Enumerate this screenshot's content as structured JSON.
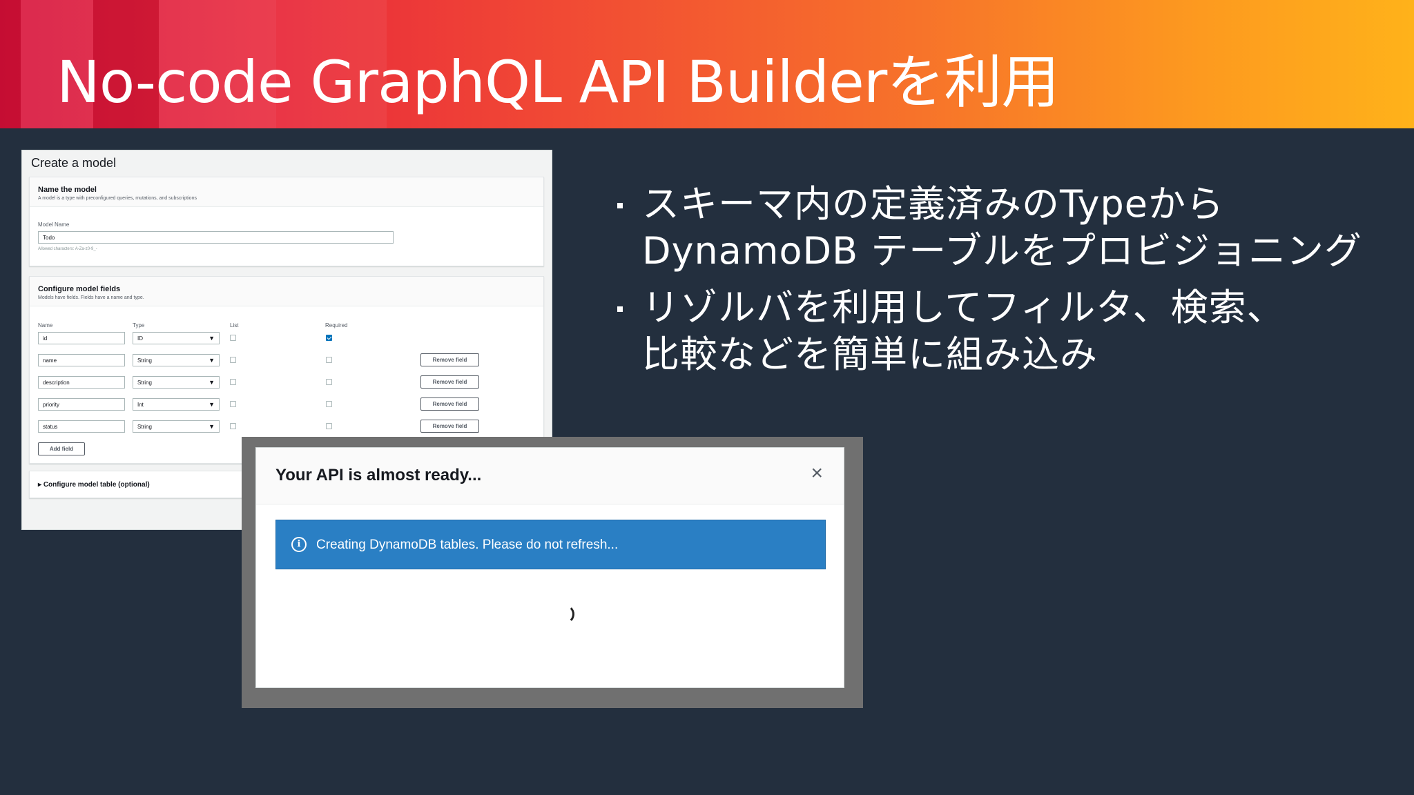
{
  "slide": {
    "title": "No-code GraphQL API Builderを利用",
    "bullets": [
      {
        "lines": [
          "スキーマ内の定義済みのTypeから",
          "DynamoDB テーブルをプロビジョニング"
        ]
      },
      {
        "lines": [
          "リゾルバを利用してフィルタ、検索、",
          "比較などを簡単に組み込み"
        ]
      }
    ]
  },
  "create_model": {
    "title": "Create a model",
    "name_section": {
      "title": "Name the model",
      "description": "A model is a type with preconfigured queries, mutations, and subscriptions",
      "field_label": "Model Name",
      "value": "Todo",
      "hint": "Allowed characters: A-Za-z0-9_-"
    },
    "fields_section": {
      "title": "Configure model fields",
      "description": "Models have fields. Fields have a name and type.",
      "headers": {
        "name": "Name",
        "type": "Type",
        "list": "List",
        "required": "Required"
      },
      "rows": [
        {
          "name": "id",
          "type": "ID",
          "list": false,
          "required": true,
          "removable": false
        },
        {
          "name": "name",
          "type": "String",
          "list": false,
          "required": false,
          "removable": true
        },
        {
          "name": "description",
          "type": "String",
          "list": false,
          "required": false,
          "removable": true
        },
        {
          "name": "priority",
          "type": "Int",
          "list": false,
          "required": false,
          "removable": true
        },
        {
          "name": "status",
          "type": "String",
          "list": false,
          "required": false,
          "removable": true
        }
      ],
      "remove_label": "Remove field",
      "add_label": "Add field"
    },
    "table_section": {
      "title": "Configure model table (optional)"
    }
  },
  "modal": {
    "title": "Your API is almost ready...",
    "close_icon": "×",
    "info_icon": "i",
    "alert_text": "Creating DynamoDB tables. Please do not refresh..."
  }
}
